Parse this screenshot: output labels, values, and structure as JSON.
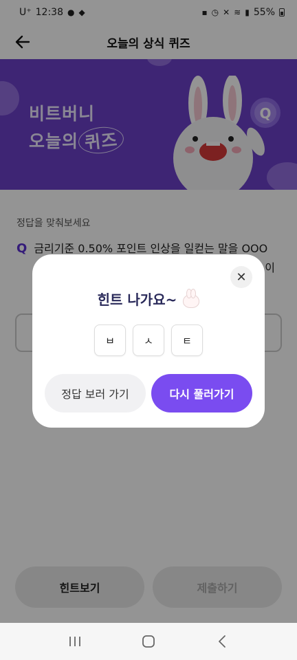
{
  "status_bar": {
    "carrier": "U⁺",
    "time": "12:38",
    "battery": "55%"
  },
  "header": {
    "title": "오늘의 상식 퀴즈",
    "back_icon": "arrow-left-icon"
  },
  "banner": {
    "line1": "비트버니",
    "line2_prefix": "오늘의",
    "line2_highlight": "퀴즈",
    "background_color": "#6b40c8",
    "mascot": "bunny-mascot"
  },
  "quiz": {
    "prompt": "정답을 맞춰보세요",
    "q_mark": "Q",
    "question_line1": "금리기준 0.50% 포인트 인상을 일컫는 말을 OOO",
    "question_line2_tail": "이"
  },
  "bottom_buttons": {
    "hint": "힌트보기",
    "submit": "제출하기"
  },
  "modal": {
    "title": "힌트 나가요~",
    "hint_letters": [
      "ㅂ",
      "ㅅ",
      "ㅌ"
    ],
    "secondary_button": "정답 보러 가기",
    "primary_button": "다시 풀러가기",
    "primary_color": "#7a4cf0",
    "close_icon": "close-icon"
  },
  "navbar": {
    "recents_icon": "recents-icon",
    "home_icon": "home-icon",
    "back_icon": "back-icon"
  }
}
